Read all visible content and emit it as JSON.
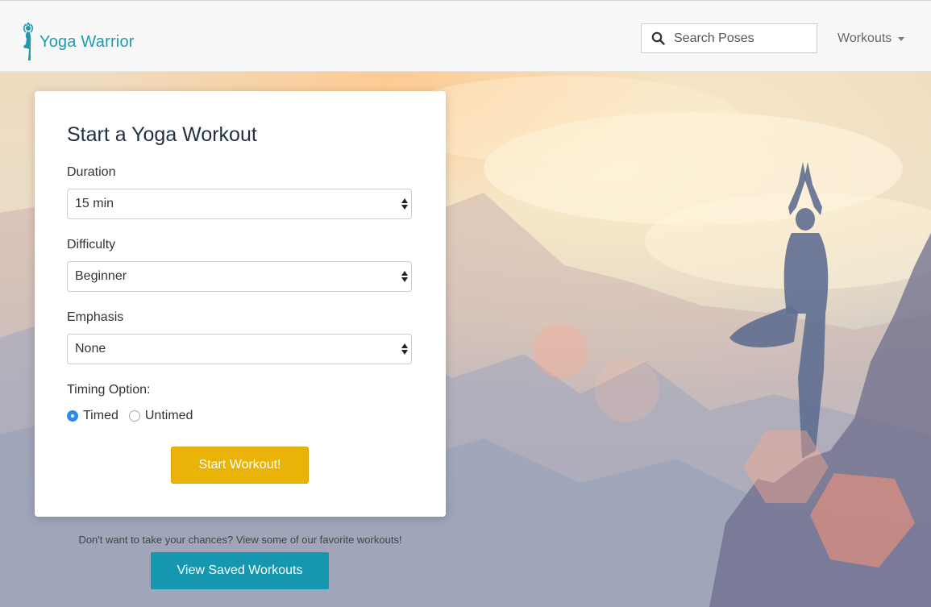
{
  "brand": {
    "name": "Yoga Warrior"
  },
  "search": {
    "placeholder": "Search Poses"
  },
  "nav": {
    "workouts_label": "Workouts"
  },
  "form": {
    "title": "Start a Yoga Workout",
    "duration": {
      "label": "Duration",
      "value": "15 min"
    },
    "difficulty": {
      "label": "Difficulty",
      "value": "Beginner"
    },
    "emphasis": {
      "label": "Emphasis",
      "value": "None"
    },
    "timing": {
      "label": "Timing Option:",
      "options": [
        {
          "label": "Timed",
          "selected": true
        },
        {
          "label": "Untimed",
          "selected": false
        }
      ]
    },
    "submit_label": "Start Workout!"
  },
  "footer": {
    "prompt": "Don't want to take your chances? View some of our favorite workouts!",
    "saved_label": "View Saved Workouts"
  },
  "colors": {
    "brand": "#1f9bb0",
    "start_button": "#eab308",
    "saved_button": "#1597b0",
    "radio_selected": "#2d8cf0"
  }
}
